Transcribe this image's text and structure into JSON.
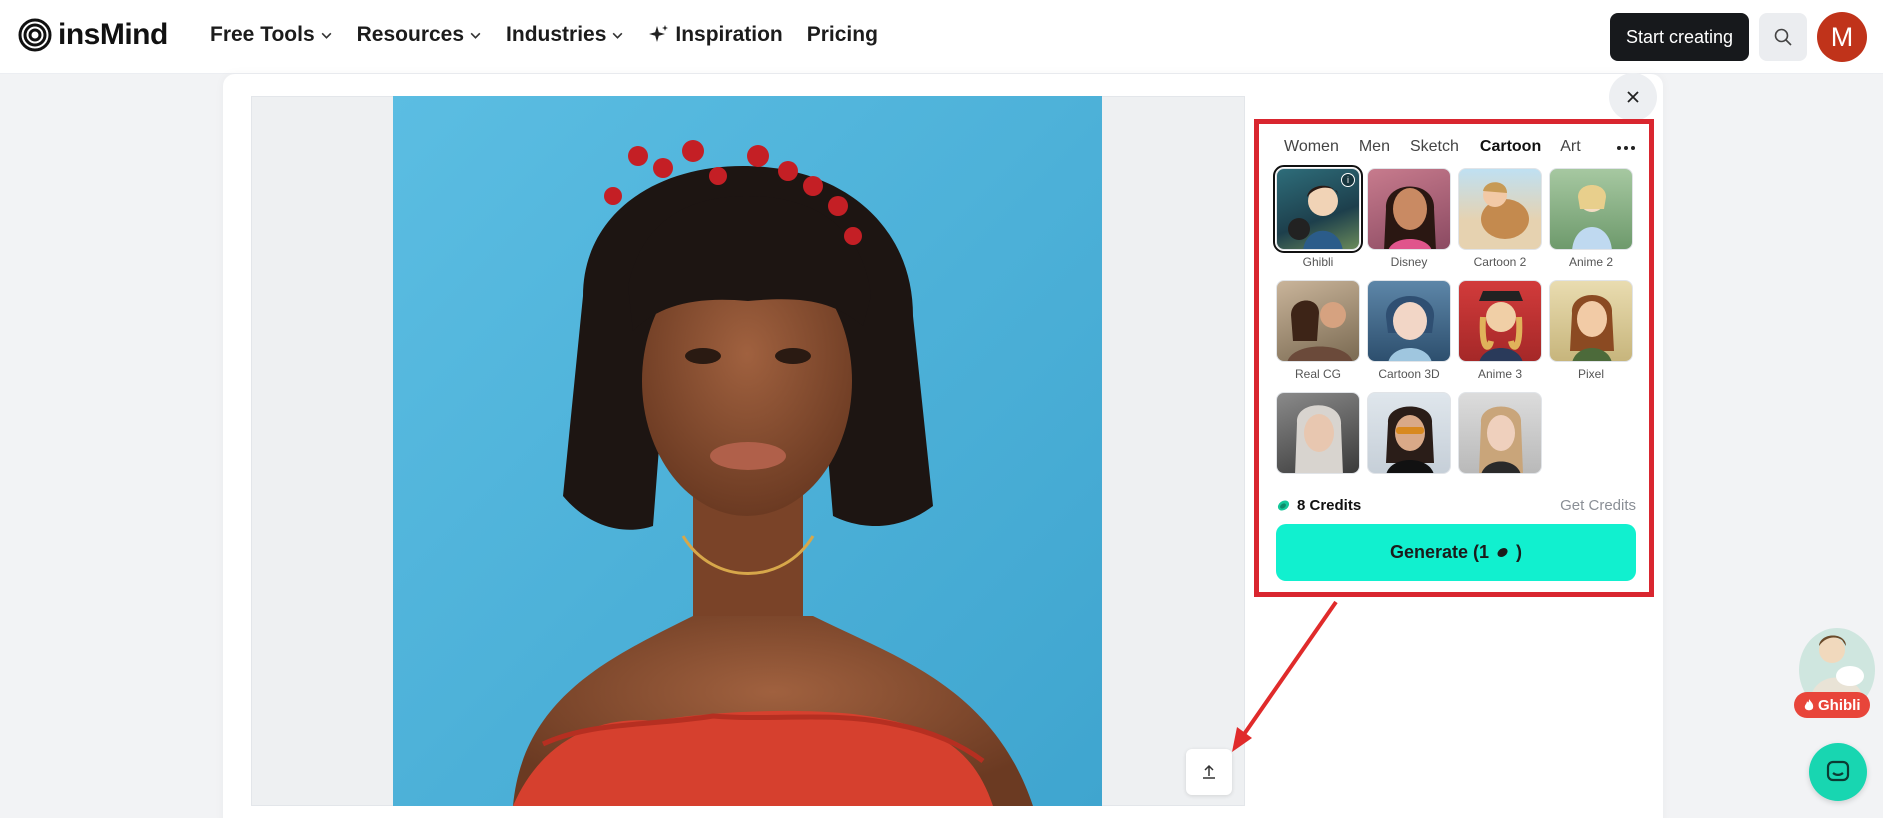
{
  "header": {
    "brand": "insMind",
    "nav": [
      {
        "label": "Free Tools",
        "dropdown": true
      },
      {
        "label": "Resources",
        "dropdown": true
      },
      {
        "label": "Industries",
        "dropdown": true
      },
      {
        "label": "Inspiration",
        "icon": "sparkle-icon"
      },
      {
        "label": "Pricing"
      }
    ],
    "start_label": "Start creating",
    "avatar_initial": "M"
  },
  "panel": {
    "tabs": [
      {
        "label": "Women",
        "active": false
      },
      {
        "label": "Men",
        "active": false
      },
      {
        "label": "Sketch",
        "active": false
      },
      {
        "label": "Cartoon",
        "active": true
      },
      {
        "label": "Art",
        "active": false
      }
    ],
    "styles": [
      {
        "label": "Ghibli",
        "selected": true
      },
      {
        "label": "Disney"
      },
      {
        "label": "Cartoon 2"
      },
      {
        "label": "Anime 2"
      },
      {
        "label": "Real CG"
      },
      {
        "label": "Cartoon 3D"
      },
      {
        "label": "Anime 3"
      },
      {
        "label": "Pixel"
      },
      {
        "label": ""
      },
      {
        "label": ""
      },
      {
        "label": ""
      }
    ],
    "credits": "8 Credits",
    "get_credits": "Get Credits",
    "generate_label": "Generate (1",
    "generate_suffix": ")"
  },
  "floating": {
    "ghibli_tag": "Ghibli"
  },
  "colors": {
    "accent": "#11f0cf",
    "highlight_border": "#d9262f",
    "arrow": "#e02b2b",
    "avatar": "#c0331a"
  }
}
